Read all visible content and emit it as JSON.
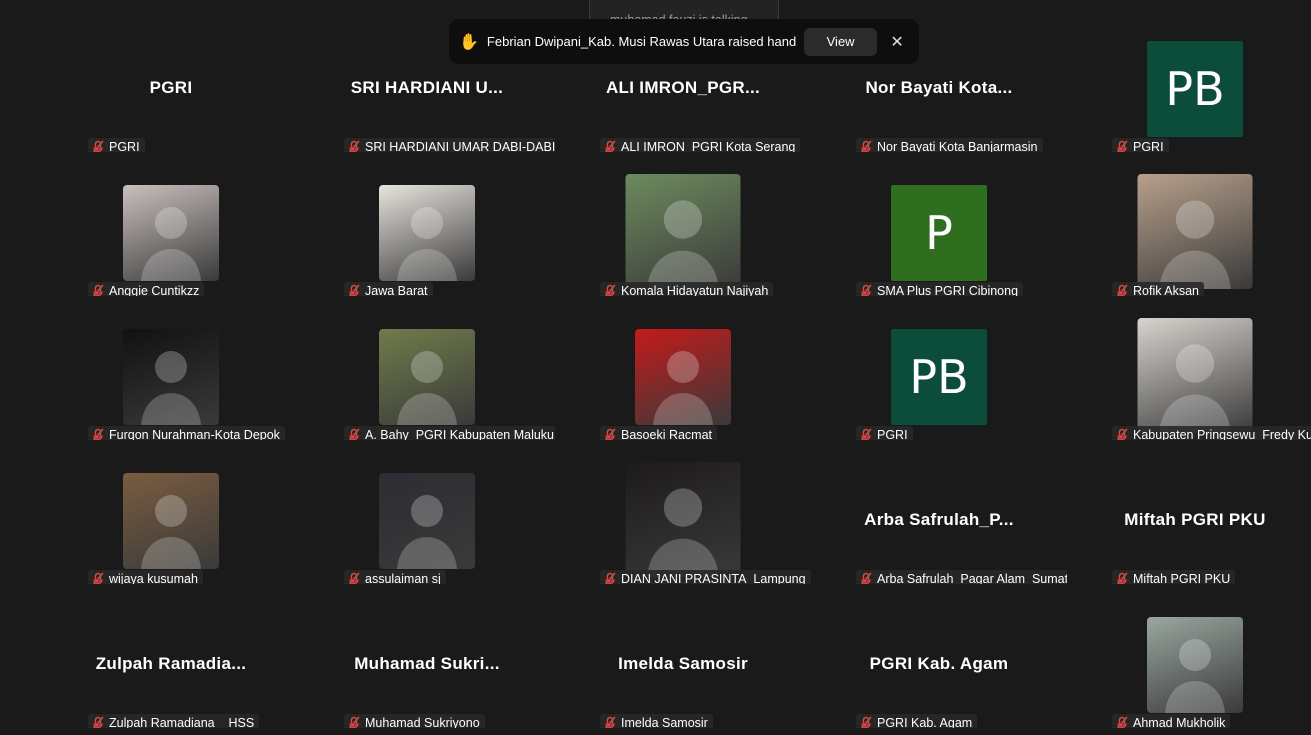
{
  "banner": {
    "talking": "muhamad fauzi is talking..."
  },
  "toast": {
    "message": "Febrian Dwipani_Kab. Musi Rawas Utara raised hand",
    "view_label": "View",
    "close_glyph": "✕",
    "hand_glyph": "✋"
  },
  "participants": [
    {
      "tag": "PGRI",
      "title": "PGRI",
      "kind": "text"
    },
    {
      "tag": "SRI HARDIANI UMAR DABI-DABI",
      "title": "SRI  HARDIANI  U...",
      "kind": "text"
    },
    {
      "tag": "ALI IMRON_PGRI Kota Serang",
      "title": "ALI  IMRON_PGR...",
      "kind": "text"
    },
    {
      "tag": "Nor Bayati Kota Banjarmasin",
      "title": "Nor  Bayati  Kota...",
      "kind": "text"
    },
    {
      "tag": "PGRI",
      "initials": "PB",
      "color": "#0b4d3a",
      "kind": "initials"
    },
    {
      "tag": "Anggie Cuntikzz",
      "kind": "photo",
      "color": "#c9c0bd"
    },
    {
      "tag": "Jawa Barat",
      "kind": "photo",
      "color": "#e8e4de"
    },
    {
      "tag": "Komala Hidayatun Najiyah",
      "kind": "photo-wide",
      "color": "#6d8a5e"
    },
    {
      "tag": "SMA Plus PGRI Cibinong",
      "initials": "P",
      "color": "#2f6e1f",
      "kind": "initials"
    },
    {
      "tag": "Rofik Aksan",
      "kind": "photo-wide",
      "color": "#b8a08c"
    },
    {
      "tag": "Furqon Nurahman-Kota Depok",
      "kind": "photo",
      "color": "#111111"
    },
    {
      "tag": "A. Bahy_PGRI Kabupaten Maluku Teng...",
      "kind": "photo",
      "color": "#6f7c4a"
    },
    {
      "tag": "Basoeki Racmat",
      "kind": "photo",
      "color": "#c41a1a"
    },
    {
      "tag": "PGRI",
      "initials": "PB",
      "color": "#0b4d3a",
      "kind": "initials"
    },
    {
      "tag": "Kabupaten Pringsewu_Fredy Kurniawan",
      "kind": "photo-wide",
      "color": "#d8d4cf"
    },
    {
      "tag": "wijaya kusumah",
      "kind": "photo",
      "color": "#7a5c3f"
    },
    {
      "tag": "assulaiman sj",
      "kind": "photo",
      "color": "#2d2d33"
    },
    {
      "tag": "DIAN JANI PRASINTA_Lampung",
      "kind": "photo-wide",
      "color": "#1d1a1c"
    },
    {
      "tag": "Arba Safrulah_Pagar Alam_Sumatera S...",
      "title": "Arba  Safrulah_P...",
      "kind": "text"
    },
    {
      "tag": "Miftah PGRI PKU",
      "title": "Miftah PGRI PKU",
      "kind": "text"
    },
    {
      "tag": "Zulpah Ramadiana _ HSS",
      "title": "Zulpah  Ramadia...",
      "kind": "text"
    },
    {
      "tag": "Muhamad Sukriyono",
      "title": "Muhamad  Sukri...",
      "kind": "text"
    },
    {
      "tag": "Imelda Samosir",
      "title": "Imelda Samosir",
      "kind": "text"
    },
    {
      "tag": "PGRI Kab. Agam",
      "title": "PGRI Kab. Agam",
      "kind": "text"
    },
    {
      "tag": "Ahmad Mukholik",
      "kind": "photo",
      "color": "#9aa7a0"
    }
  ]
}
